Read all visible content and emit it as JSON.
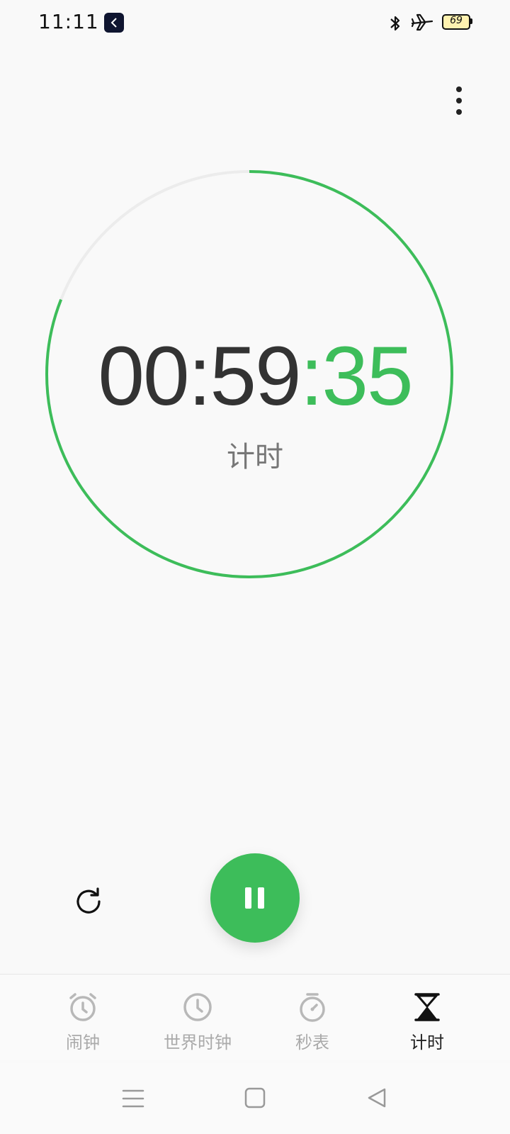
{
  "status_bar": {
    "time": "11:11",
    "battery_level": "69",
    "icons": [
      "app-notification-icon",
      "bluetooth-icon",
      "airplane-icon",
      "battery-icon"
    ]
  },
  "timer": {
    "time_main": "00:59",
    "time_seconds": ":35",
    "label": "计时",
    "progress_fraction": 0.81,
    "accent_color": "#3dbd5a"
  },
  "controls": {
    "reset_icon": "refresh-icon",
    "pause_icon": "pause-icon"
  },
  "bottom_nav": {
    "items": [
      {
        "label": "闹钟",
        "icon": "alarm-icon"
      },
      {
        "label": "世界时钟",
        "icon": "clock-icon"
      },
      {
        "label": "秒表",
        "icon": "stopwatch-icon"
      },
      {
        "label": "计时",
        "icon": "hourglass-icon",
        "active": true
      }
    ]
  },
  "system_nav": {
    "icons": [
      "menu-icon",
      "home-icon",
      "back-icon"
    ]
  }
}
